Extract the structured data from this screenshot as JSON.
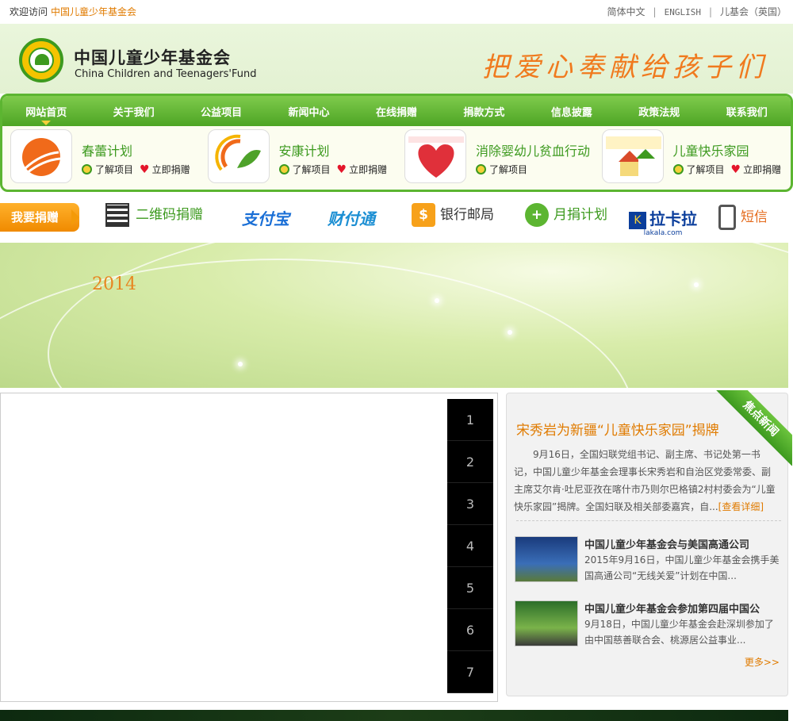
{
  "topbar": {
    "welcome": "欢迎访问",
    "org": "中国儿童少年基金会",
    "langs": [
      "简体中文",
      "ENGLISH",
      "儿基会（英国）"
    ]
  },
  "header": {
    "logo_cn": "中国儿童少年基金会",
    "logo_en": "China Children and Teenagers'Fund",
    "slogan": "把爱心奉献给孩子们"
  },
  "nav": [
    "网站首页",
    "关于我们",
    "公益项目",
    "新闻中心",
    "在线捐赠",
    "捐款方式",
    "信息披露",
    "政策法规",
    "联系我们"
  ],
  "projects": [
    {
      "name": "春蕾计划",
      "learn": "了解项目",
      "donate": "立即捐赠"
    },
    {
      "name": "安康计划",
      "learn": "了解项目",
      "donate": "立即捐赠"
    },
    {
      "name": "消除婴幼儿贫血行动",
      "learn": "了解项目",
      "donate": ""
    },
    {
      "name": "儿童快乐家园",
      "learn": "了解项目",
      "donate": "立即捐赠"
    }
  ],
  "donate_bar": {
    "button": "我要捐赠",
    "qr": "二维码捐赠",
    "alipay": "支付宝",
    "tenpay": "财付通",
    "bank": "银行邮局",
    "monthly": "月捐计划",
    "lakala": "拉卡拉",
    "lakala_sub": "lakala.com",
    "sms": "短信"
  },
  "banner": {
    "year": "2014"
  },
  "slider": {
    "pages": [
      "1",
      "2",
      "3",
      "4",
      "5",
      "6",
      "7"
    ]
  },
  "news": {
    "ribbon": "焦点新闻",
    "headline": "宋秀岩为新疆“儿童快乐家园”揭牌",
    "lead": "9月16日，全国妇联党组书记、副主席、书记处第一书记，中国儿童少年基金会理事长宋秀岩和自治区党委常委、副主席艾尔肯·吐尼亚孜在喀什市乃则尔巴格镇2村村委会为“儿童快乐家园”揭牌。全国妇联及相关部委嘉宾，自...",
    "lead_more": "[查看详细]",
    "items": [
      {
        "title": "中国儿童少年基金会与美国高通公司",
        "desc": "2015年9月16日，中国儿童少年基金会携手美国高通公司“无线关爱”计划在中国..."
      },
      {
        "title": "中国儿童少年基金会参加第四届中国公",
        "desc": "9月18日，中国儿童少年基金会赴深圳参加了由中国慈善联合会、桃源居公益事业..."
      }
    ],
    "more": "更多>>"
  }
}
